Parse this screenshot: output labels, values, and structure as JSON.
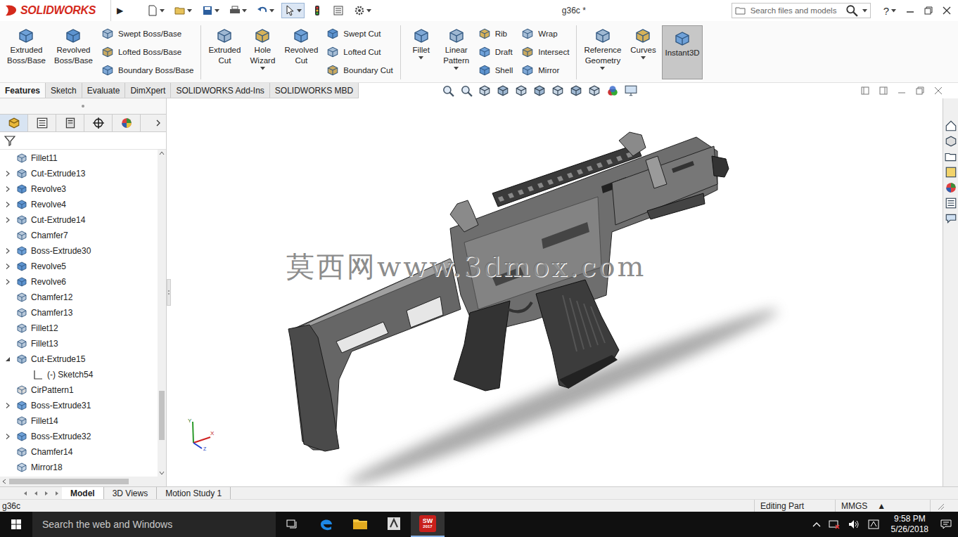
{
  "title_bar": {
    "logo": "SOLIDWORKS",
    "expand": "▶",
    "title": "g36c *",
    "search_placeholder": "Search files and models",
    "help": "?"
  },
  "ribbon": {
    "groups": [
      {
        "large": [
          {
            "lines": [
              "Extruded",
              "Boss/Base"
            ],
            "dropdown": false,
            "selected": false
          },
          {
            "lines": [
              "Revolved",
              "Boss/Base"
            ],
            "dropdown": false,
            "selected": false
          }
        ],
        "columns": [
          [
            {
              "label": "Swept Boss/Base"
            },
            {
              "label": "Lofted Boss/Base"
            },
            {
              "label": "Boundary Boss/Base"
            }
          ]
        ]
      },
      {
        "large": [
          {
            "lines": [
              "Extruded",
              "Cut"
            ],
            "dropdown": false,
            "selected": false
          },
          {
            "lines": [
              "Hole",
              "Wizard"
            ],
            "dropdown": true,
            "selected": false
          },
          {
            "lines": [
              "Revolved",
              "Cut"
            ],
            "dropdown": false,
            "selected": false
          }
        ],
        "columns": [
          [
            {
              "label": "Swept Cut"
            },
            {
              "label": "Lofted Cut"
            },
            {
              "label": "Boundary Cut"
            }
          ]
        ]
      },
      {
        "large": [
          {
            "lines": [
              "Fillet"
            ],
            "dropdown": true,
            "selected": false
          },
          {
            "lines": [
              "Linear",
              "Pattern"
            ],
            "dropdown": true,
            "selected": false
          }
        ],
        "columns": [
          [
            {
              "label": "Rib"
            },
            {
              "label": "Draft"
            },
            {
              "label": "Shell"
            }
          ],
          [
            {
              "label": "Wrap"
            },
            {
              "label": "Intersect"
            },
            {
              "label": "Mirror"
            }
          ]
        ]
      },
      {
        "large": [
          {
            "lines": [
              "Reference",
              "Geometry"
            ],
            "dropdown": true,
            "selected": false
          },
          {
            "lines": [
              "Curves"
            ],
            "dropdown": true,
            "selected": false
          },
          {
            "lines": [
              "Instant3D"
            ],
            "dropdown": false,
            "selected": true
          }
        ],
        "columns": []
      }
    ]
  },
  "command_tabs": [
    {
      "label": "Features",
      "selected": true
    },
    {
      "label": "Sketch",
      "selected": false
    },
    {
      "label": "Evaluate",
      "selected": false
    },
    {
      "label": "DimXpert",
      "selected": false
    },
    {
      "label": "SOLIDWORKS Add-Ins",
      "selected": false
    },
    {
      "label": "SOLIDWORKS MBD",
      "selected": false
    }
  ],
  "panel_tabs": [
    {
      "selected": true
    },
    {
      "selected": false
    },
    {
      "selected": false
    },
    {
      "selected": false
    },
    {
      "selected": false
    }
  ],
  "feature_tree": [
    {
      "name": "Fillet11",
      "kind": "feature",
      "expandable": false,
      "expanded": false
    },
    {
      "name": "Cut-Extrude13",
      "kind": "feature",
      "expandable": true,
      "expanded": false
    },
    {
      "name": "Revolve3",
      "kind": "feature",
      "expandable": true,
      "expanded": false
    },
    {
      "name": "Revolve4",
      "kind": "feature",
      "expandable": true,
      "expanded": false
    },
    {
      "name": "Cut-Extrude14",
      "kind": "feature",
      "expandable": true,
      "expanded": false
    },
    {
      "name": "Chamfer7",
      "kind": "feature",
      "expandable": false,
      "expanded": false
    },
    {
      "name": "Boss-Extrude30",
      "kind": "feature",
      "expandable": true,
      "expanded": false
    },
    {
      "name": "Revolve5",
      "kind": "feature",
      "expandable": true,
      "expanded": false
    },
    {
      "name": "Revolve6",
      "kind": "feature",
      "expandable": true,
      "expanded": false
    },
    {
      "name": "Chamfer12",
      "kind": "feature",
      "expandable": false,
      "expanded": false
    },
    {
      "name": "Chamfer13",
      "kind": "feature",
      "expandable": false,
      "expanded": false
    },
    {
      "name": "Fillet12",
      "kind": "feature",
      "expandable": false,
      "expanded": false
    },
    {
      "name": "Fillet13",
      "kind": "feature",
      "expandable": false,
      "expanded": false
    },
    {
      "name": "Cut-Extrude15",
      "kind": "feature",
      "expandable": true,
      "expanded": true
    },
    {
      "name": "(-) Sketch54",
      "kind": "sketch",
      "expandable": false,
      "expanded": false
    },
    {
      "name": "CirPattern1",
      "kind": "feature",
      "expandable": false,
      "expanded": false
    },
    {
      "name": "Boss-Extrude31",
      "kind": "feature",
      "expandable": true,
      "expanded": false
    },
    {
      "name": "Fillet14",
      "kind": "feature",
      "expandable": false,
      "expanded": false
    },
    {
      "name": "Boss-Extrude32",
      "kind": "feature",
      "expandable": true,
      "expanded": false
    },
    {
      "name": "Chamfer14",
      "kind": "feature",
      "expandable": false,
      "expanded": false
    },
    {
      "name": "Mirror18",
      "kind": "feature",
      "expandable": false,
      "expanded": false
    }
  ],
  "model_view": {
    "watermark": "莫西网www.3dmox.com",
    "triad_axes": [
      "Y",
      "X",
      "Z"
    ]
  },
  "bottom_tabs": [
    {
      "label": "Model",
      "selected": true
    },
    {
      "label": "3D Views",
      "selected": false
    },
    {
      "label": "Motion Study 1",
      "selected": false
    }
  ],
  "status_bar": {
    "document": "g36c",
    "mode": "Editing Part",
    "units": "MMGS",
    "units_menu": "▲"
  },
  "taskbar": {
    "search_placeholder": "Search the web and Windows",
    "app_badge": "SW",
    "app_version": "2017",
    "time": "9:58 PM",
    "date": "5/26/2018"
  }
}
